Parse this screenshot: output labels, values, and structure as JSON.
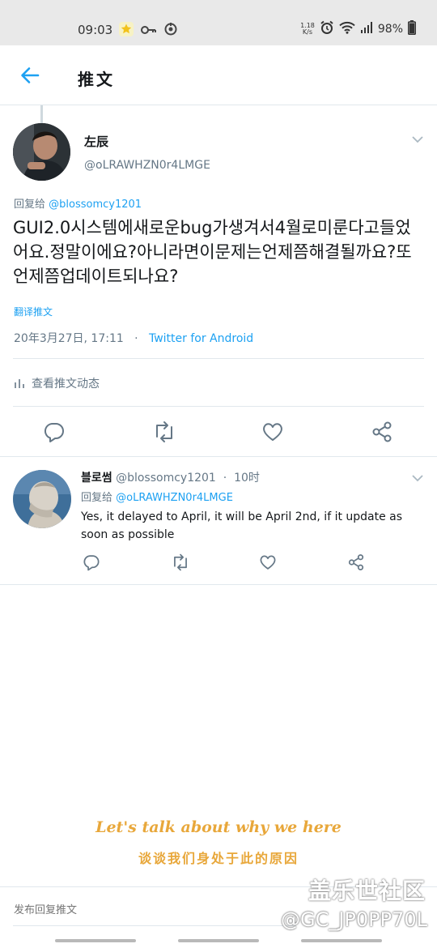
{
  "status_bar": {
    "time": "09:03",
    "speed_top": "1.18",
    "speed_bottom": "K/s",
    "battery": "98%"
  },
  "header": {
    "title": "推文"
  },
  "main_tweet": {
    "name": "左辰",
    "handle": "@oLRAWHZN0r4LMGE",
    "reply_prefix": "回复给",
    "reply_mention": "@blossomcy1201",
    "text": "GUI2.0시스템에새로운bug가생겨서4월로미룬다고들었어요.정말이에요?아니라면이문제는언제쯤해결될까요?또언제쯤업데이트되나요?",
    "translate_label": "翻译推文",
    "date": "20年3月27日, 17:11",
    "separator": "·",
    "source": "Twitter for Android",
    "activity_label": "查看推文动态"
  },
  "reply_tweet": {
    "name": "블로썸",
    "handle": "@blossomcy1201",
    "dot": "·",
    "time": "10时",
    "reply_prefix": "回复给",
    "reply_mention": "@oLRAWHZN0r4LMGE",
    "text": "Yes, it delayed to April, it will be April 2nd, if it update as soon as possible"
  },
  "watermark": {
    "line1": "Let's talk about why we here",
    "line2": "谈谈我们身处于此的原因",
    "site": "盖乐世社区",
    "user": "@GC_JP0PP70L"
  },
  "composer": {
    "placeholder": "发布回复推文"
  },
  "colors": {
    "accent": "#1da1f2",
    "secondary_text": "#657786",
    "watermark": "#e8a73a"
  },
  "icons": {
    "back": "arrow-left-icon",
    "caret": "chevron-down-icon",
    "reply": "reply-icon",
    "retweet": "retweet-icon",
    "like": "heart-icon",
    "share": "share-icon",
    "activity": "bar-chart-icon"
  }
}
